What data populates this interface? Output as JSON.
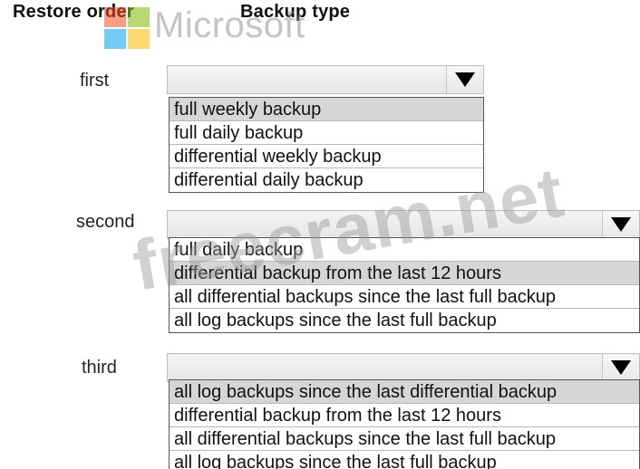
{
  "header": {
    "left": "Restore order",
    "right": "Backup type"
  },
  "watermarks": {
    "microsoft": "Microsoft",
    "freecram": "freecram.net"
  },
  "rows": [
    {
      "label": "first",
      "dropdown_icon": "triangle-down-icon",
      "options": [
        "full weekly backup",
        "full daily backup",
        "differential weekly backup",
        "differential daily backup"
      ],
      "highlighted": 0
    },
    {
      "label": "second",
      "dropdown_icon": "triangle-down-icon",
      "options": [
        "full daily backup",
        "differential backup from the last 12 hours",
        "all differential backups since the last full backup",
        "all log backups since the last full backup"
      ],
      "highlighted": 1
    },
    {
      "label": "third",
      "dropdown_icon": "triangle-down-icon",
      "options": [
        "all log backups since the last differential backup",
        "differential backup from the last 12 hours",
        "all differential backups since the last full backup",
        "all log backups since the last full backup"
      ],
      "highlighted": 0
    }
  ],
  "colors": {
    "highlight": "#d6d6d6",
    "combo_bg": "#ececec"
  }
}
